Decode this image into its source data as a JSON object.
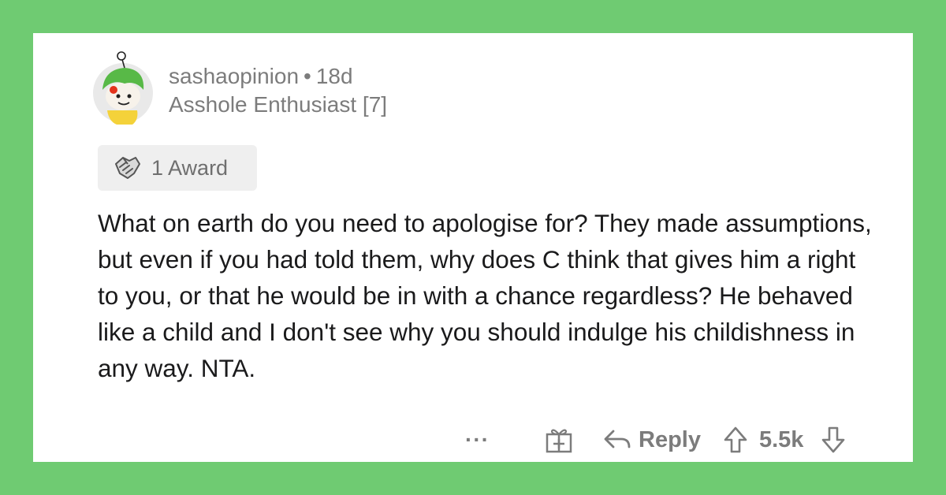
{
  "comment": {
    "username": "sashaopinion",
    "separator": "•",
    "age": "18d",
    "flair": "Asshole Enthusiast [7]",
    "award_label": "1 Award",
    "award_icon": "handshake-award-icon",
    "body": "What on earth do you need to apologise for? They made assumptions, but even if you had told them, why does C think that gives him a right to you, or that he would be in with a chance regardless? He behaved like a child and I don't see why you should indulge his childishness in any way. NTA."
  },
  "actions": {
    "more_label": "···",
    "reply_label": "Reply",
    "score": "5.5k"
  },
  "colors": {
    "background": "#6fcb72",
    "card": "#ffffff",
    "meta_text": "#7c7c7c",
    "body_text": "#1a1a1b",
    "award_bg": "#efefef"
  }
}
